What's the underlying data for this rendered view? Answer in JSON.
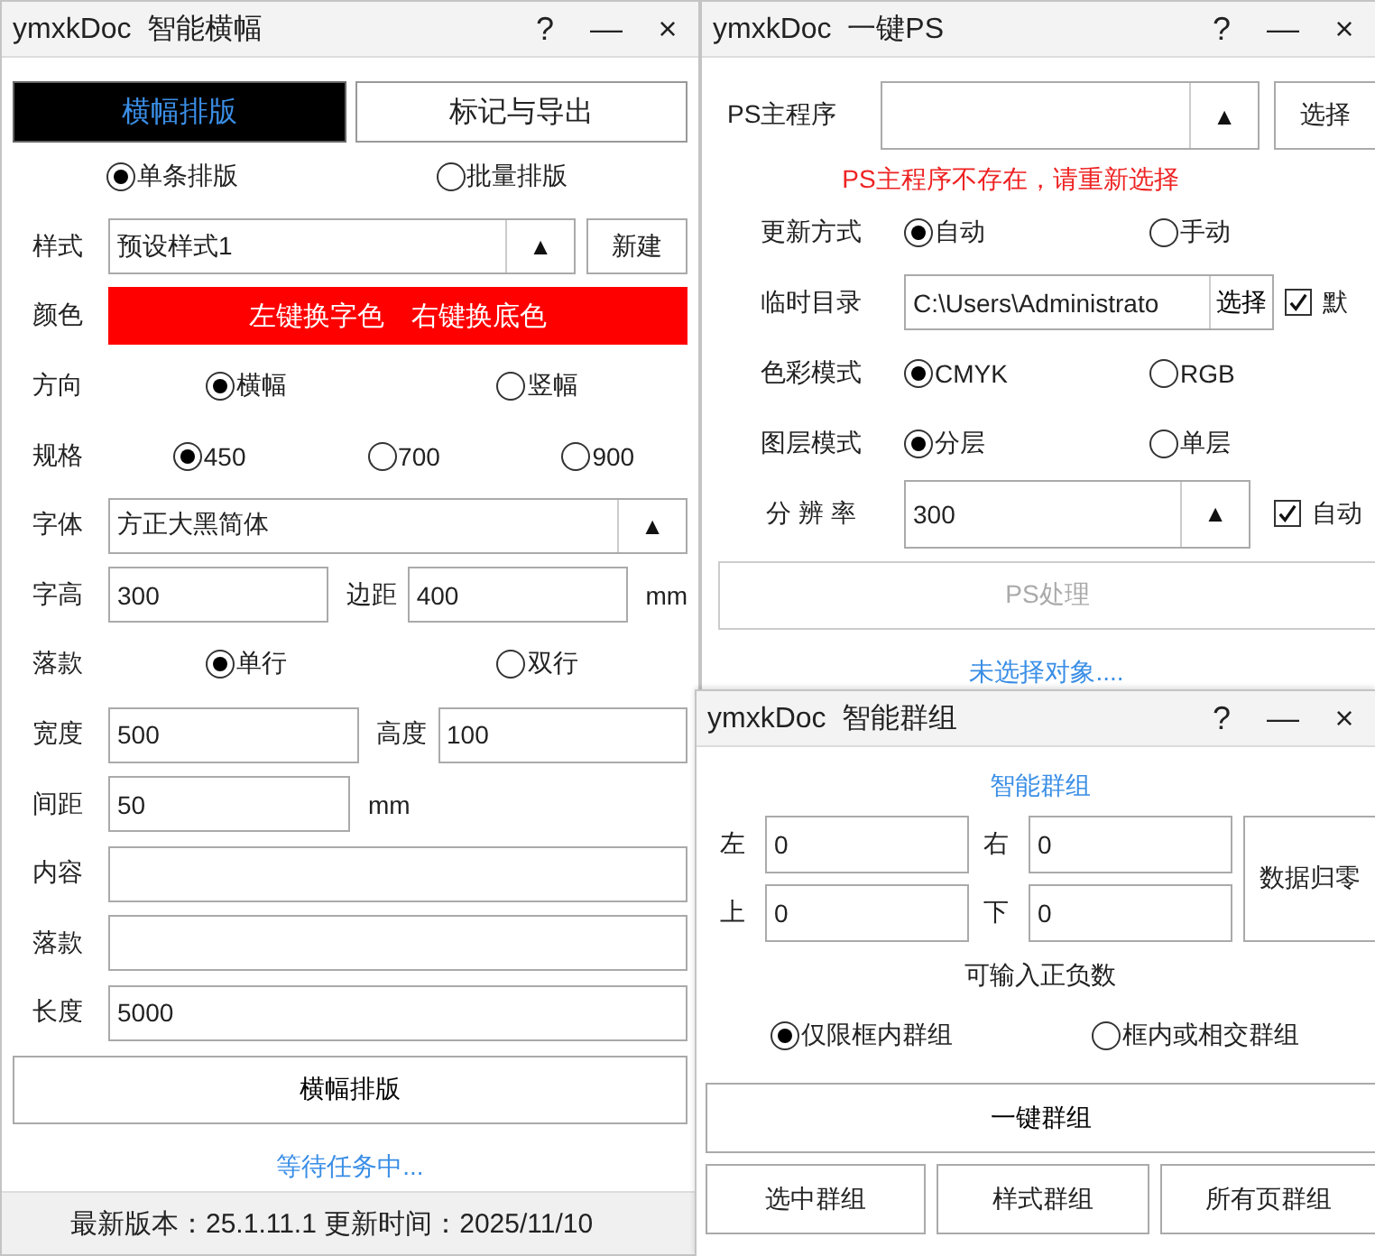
{
  "banner_window": {
    "title": "ymxkDoc  智能横幅",
    "title_buttons": [
      "?",
      "—",
      "×"
    ],
    "tabs": [
      {
        "label": "横幅排版",
        "selected": true
      },
      {
        "label": "标记与导出",
        "selected": false
      }
    ],
    "rows": [
      {
        "kind": "radio",
        "options": [
          {
            "label": "单条排版",
            "selected": true
          },
          {
            "label": "批量排版",
            "selected": false
          }
        ]
      },
      {
        "kind": "combo",
        "label": "样式",
        "value": "预设样式1",
        "arrow": "▲",
        "button": "新建"
      },
      {
        "kind": "swatch",
        "label": "颜色",
        "text": "左键换字色　右键换底色"
      },
      {
        "kind": "radio",
        "label": "方向",
        "options": [
          {
            "label": "横幅",
            "selected": true
          },
          {
            "label": "竖幅",
            "selected": false
          }
        ]
      },
      {
        "kind": "radio",
        "label": "规格",
        "options": [
          {
            "label": "450",
            "selected": true
          },
          {
            "label": "700",
            "selected": false
          },
          {
            "label": "900",
            "selected": false
          }
        ]
      },
      {
        "kind": "combo",
        "label": "字体",
        "value": "方正大黑简体",
        "arrow": "▲"
      },
      {
        "kind": "fields",
        "label": "字高",
        "fields": [
          {
            "value": "300"
          },
          {
            "label": "边距",
            "value": "400"
          }
        ],
        "unit": "mm"
      },
      {
        "kind": "radio",
        "label": "落款",
        "options": [
          {
            "label": "单行",
            "selected": true
          },
          {
            "label": "双行",
            "selected": false
          }
        ]
      },
      {
        "kind": "fields",
        "label": "宽度",
        "fields": [
          {
            "value": "500"
          },
          {
            "label": "高度",
            "value": "100"
          }
        ]
      },
      {
        "kind": "fields",
        "label": "间距",
        "fields": [
          {
            "value": "50"
          }
        ],
        "unit": "mm"
      },
      {
        "kind": "field",
        "label": "内容"
      },
      {
        "kind": "field",
        "label": "落款"
      },
      {
        "kind": "field",
        "label": "长度",
        "value": "5000"
      }
    ],
    "action_button": "横幅排版",
    "status": "等待任务中...",
    "footer": "最新版本：25.1.11.1 更新时间：2025/11/10"
  },
  "ps_window": {
    "title": "ymxkDoc  一键PS",
    "title_buttons": [
      "?",
      "—",
      "×"
    ],
    "program": {
      "label": "PS主程序",
      "arrow": "▲",
      "button": "选择"
    },
    "error": "PS主程序不存在，请重新选择",
    "update_mode": {
      "label": "更新方式",
      "options": [
        {
          "label": "自动",
          "selected": true
        },
        {
          "label": "手动",
          "selected": false
        }
      ]
    },
    "temp_dir": {
      "label": "临时目录",
      "value": "C:\\Users\\Administrato",
      "button": "选择",
      "checkbox": {
        "label": "默",
        "checked": true
      }
    },
    "color_mode": {
      "label": "色彩模式",
      "options": [
        {
          "label": "CMYK",
          "selected": true
        },
        {
          "label": "RGB",
          "selected": false
        }
      ]
    },
    "layer_mode": {
      "label": "图层模式",
      "options": [
        {
          "label": "分层",
          "selected": true
        },
        {
          "label": "单层",
          "selected": false
        }
      ]
    },
    "resolution": {
      "label": "分 辨 率",
      "value": "300",
      "arrow": "▲",
      "checkbox": {
        "label": "自动",
        "checked": true
      }
    },
    "process_button": {
      "label": "PS处理",
      "disabled": true
    },
    "status": "未选择对象...."
  },
  "group_window": {
    "title": "ymxkDoc  智能群组",
    "title_buttons": [
      "?",
      "—",
      "×"
    ],
    "heading": "智能群组",
    "offsets": [
      {
        "label": "左",
        "value": "0"
      },
      {
        "label": "右",
        "value": "0"
      },
      {
        "label": "上",
        "value": "0"
      },
      {
        "label": "下",
        "value": "0"
      }
    ],
    "reset_button": "数据归零",
    "hint": "可输入正负数",
    "scope_options": [
      {
        "label": "仅限框内群组",
        "selected": true
      },
      {
        "label": "框内或相交群组",
        "selected": false
      }
    ],
    "group_button": "一键群组",
    "buttons": [
      "选中群组",
      "样式群组",
      "所有页群组"
    ]
  }
}
